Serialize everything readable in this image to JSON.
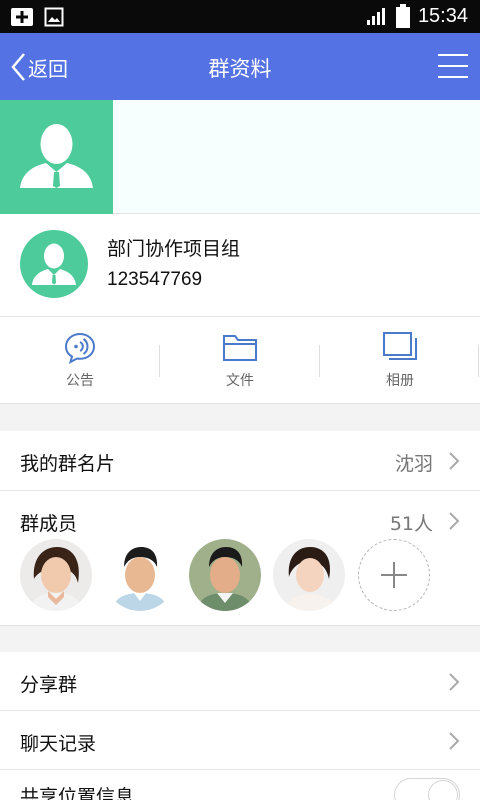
{
  "status_bar": {
    "time": "15:34"
  },
  "header": {
    "back_label": "返回",
    "title": "群资料"
  },
  "group": {
    "name": "部门协作项目组",
    "id": "123547769"
  },
  "tools": [
    {
      "label": "公告",
      "icon": "announcement-icon"
    },
    {
      "label": "文件",
      "icon": "folder-icon"
    },
    {
      "label": "相册",
      "icon": "album-icon"
    }
  ],
  "my_card": {
    "label": "我的群名片",
    "value": "沈羽"
  },
  "members": {
    "label": "群成员",
    "count": "51人",
    "avatars": [
      "member-avatar-1",
      "member-avatar-2",
      "member-avatar-3",
      "member-avatar-4"
    ]
  },
  "share": {
    "label": "分享群"
  },
  "history": {
    "label": "聊天记录"
  },
  "location": {
    "label": "共享位置信息"
  },
  "colors": {
    "accent": "#5472e4",
    "avatar_green": "#4ecb9a"
  }
}
